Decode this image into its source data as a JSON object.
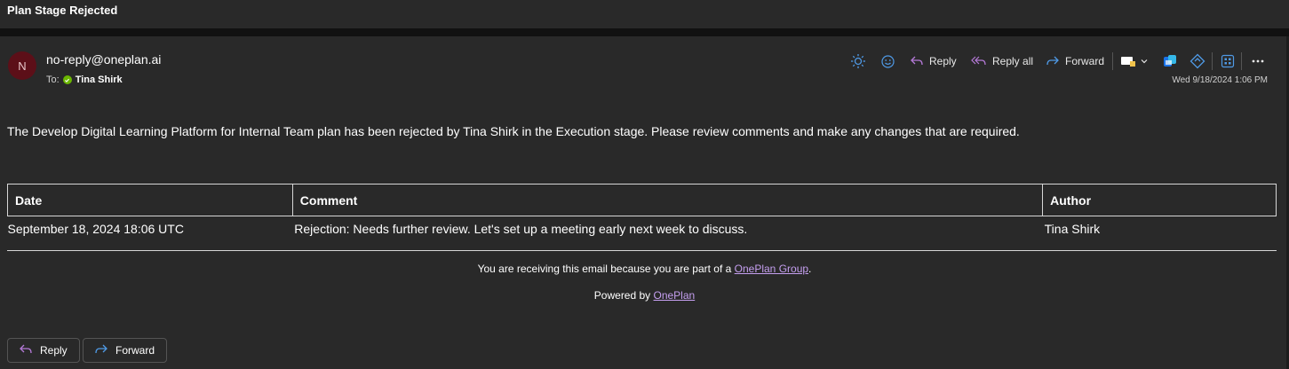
{
  "subject": "Plan Stage Rejected",
  "sender": {
    "initial": "N",
    "email": "no-reply@oneplan.ai",
    "to_label": "To:",
    "recipient": "Tina Shirk"
  },
  "toolbar": {
    "reply_label": "Reply",
    "reply_all_label": "Reply all",
    "forward_label": "Forward",
    "icons": [
      "sun-icon",
      "emoji-icon",
      "reply-icon",
      "reply-all-icon",
      "forward-icon",
      "mark-icon",
      "chevron-down-icon",
      "copilot-icon",
      "loop-icon",
      "apps-icon",
      "more-icon"
    ]
  },
  "timestamp": "Wed 9/18/2024 1:06 PM",
  "body": {
    "message": "The Develop Digital Learning Platform for Internal Team plan has been rejected by Tina Shirk in the Execution stage. Please review comments and make any changes that are required."
  },
  "table": {
    "headers": [
      "Date",
      "Comment",
      "Author"
    ],
    "rows": [
      [
        "September 18, 2024 18:06 UTC",
        "Rejection: Needs further review. Let's set up a meeting early next week to discuss.",
        "Tina Shirk"
      ]
    ]
  },
  "footer": {
    "receiving_prefix": "You are receiving this email because you are part of a ",
    "group_link": "OnePlan Group",
    "receiving_suffix": ".",
    "powered_prefix": "Powered by ",
    "powered_link": "OnePlan"
  },
  "actions": {
    "reply_label": "Reply",
    "forward_label": "Forward"
  },
  "colors": {
    "background": "#292929",
    "avatar": "#5c0f18",
    "presence": "#6bb700",
    "link": "#c59ff0",
    "accent_icon": "#4f9ae6"
  }
}
